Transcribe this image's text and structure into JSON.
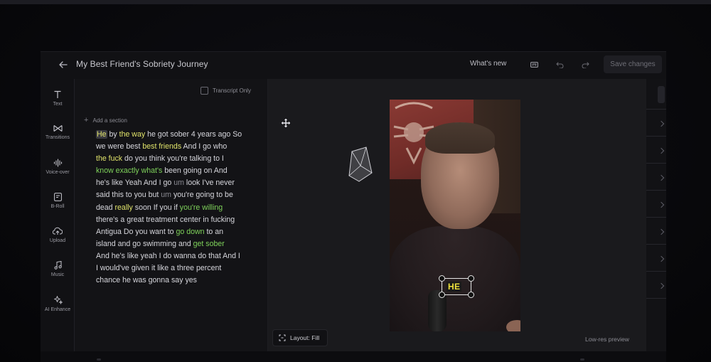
{
  "header": {
    "title": "My Best Friend's Sobriety Journey",
    "whats_new": "What's new",
    "save_label": "Save changes"
  },
  "toolbar": {
    "items": [
      {
        "label": "Text",
        "icon": "text-icon"
      },
      {
        "label": "Transitions",
        "icon": "transitions-icon"
      },
      {
        "label": "Voice-over",
        "icon": "voice-over-icon"
      },
      {
        "label": "B-Roll",
        "icon": "b-roll-icon"
      },
      {
        "label": "Upload",
        "icon": "upload-icon"
      },
      {
        "label": "Music",
        "icon": "music-icon"
      },
      {
        "label": "AI Enhance",
        "icon": "ai-enhance-icon"
      }
    ]
  },
  "transcript": {
    "transcript_only_label": "Transcript Only",
    "add_section_label": "Add a section",
    "lines": [
      [
        {
          "t": "He",
          "c": "first"
        },
        {
          "t": " by "
        },
        {
          "t": "the way",
          "c": "yellow"
        },
        {
          "t": " he got sober 4 years ago So"
        }
      ],
      [
        {
          "t": "we were best "
        },
        {
          "t": "best friends",
          "c": "yellow"
        },
        {
          "t": " And I go who"
        }
      ],
      [
        {
          "t": "the fuck",
          "c": "yellow"
        },
        {
          "t": " do you think you're talking to I"
        }
      ],
      [
        {
          "t": "know exactly ",
          "c": "green"
        },
        {
          "t": " what's",
          "c": "green"
        },
        {
          "t": " been going on And"
        }
      ],
      [
        {
          "t": "he's like Yeah And I go "
        },
        {
          "t": "um",
          "c": "dim"
        },
        {
          "t": " look I've never"
        }
      ],
      [
        {
          "t": "said this to you but "
        },
        {
          "t": "um",
          "c": "dim"
        },
        {
          "t": " you're going to be"
        }
      ],
      [
        {
          "t": "dead "
        },
        {
          "t": "really",
          "c": "yellow"
        },
        {
          "t": " soon If you if "
        },
        {
          "t": "you're willing",
          "c": "green"
        }
      ],
      [
        {
          "t": "there's a great treatment center in fucking"
        }
      ],
      [
        {
          "t": "Antigua Do you want to "
        },
        {
          "t": "go down",
          "c": "green"
        },
        {
          "t": " to an"
        }
      ],
      [
        {
          "t": "island and go swimming and "
        },
        {
          "t": "get sober",
          "c": "green"
        }
      ],
      [
        {
          "t": "And he's like yeah I do wanna do that And I"
        }
      ],
      [
        {
          "t": "I would've given it like a three percent"
        }
      ],
      [
        {
          "t": "chance he was gonna say yes"
        }
      ]
    ]
  },
  "preview": {
    "caption_text": "HE",
    "layout_label": "Layout: Fill",
    "lowres_label": "Low-res preview"
  },
  "colors": {
    "highlight_yellow": "#e0e36a",
    "highlight_green": "#7ed15a",
    "caption_yellow": "#f1e23c"
  }
}
